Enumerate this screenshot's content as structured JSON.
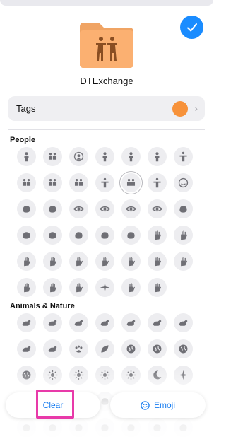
{
  "folder": {
    "name": "DTExchange",
    "color": "#f7923a"
  },
  "tags": {
    "label": "Tags",
    "dot_color": "#f7923a"
  },
  "sections": [
    {
      "title": "People",
      "rows": 6
    },
    {
      "title": "Animals & Nature",
      "rows": 5
    }
  ],
  "buttons": {
    "clear": "Clear",
    "emoji": "Emoji"
  },
  "colors": {
    "accent": "#1a7ef0",
    "highlight": "#e83aa9",
    "cell_bg": "#ededf0"
  }
}
